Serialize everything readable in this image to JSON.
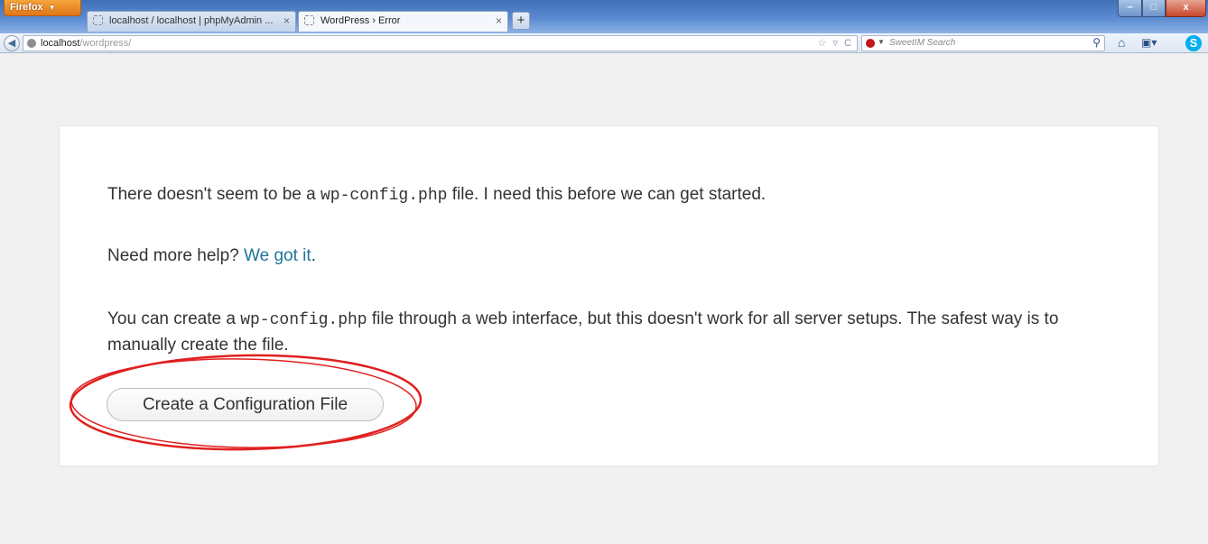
{
  "browser": {
    "menu_button_label": "Firefox",
    "tabs": [
      {
        "title": "localhost / localhost | phpMyAdmin ...",
        "active": false
      },
      {
        "title": "WordPress › Error",
        "active": true
      }
    ],
    "new_tab_label": "+",
    "url": {
      "host": "localhost",
      "path": "/wordpress/"
    },
    "search": {
      "placeholder": "SweetIM Search"
    },
    "window_controls": {
      "minimize": "–",
      "maximize": "□",
      "close": "x"
    }
  },
  "page": {
    "message_1": {
      "before": "There doesn't seem to be a ",
      "code": "wp-config.php",
      "after": " file. I need this before we can get started."
    },
    "message_2": {
      "before": "Need more help? ",
      "link": "We got it",
      "after": "."
    },
    "message_3": {
      "before": "You can create a ",
      "code": "wp-config.php",
      "after": " file through a web interface, but this doesn't work for all server setups. The safest way is to manually create the file."
    },
    "create_config_button": "Create a Configuration File"
  },
  "colors": {
    "link": "#21759b",
    "annotation": "#e0201f",
    "page_bg": "#f1f1f1"
  }
}
